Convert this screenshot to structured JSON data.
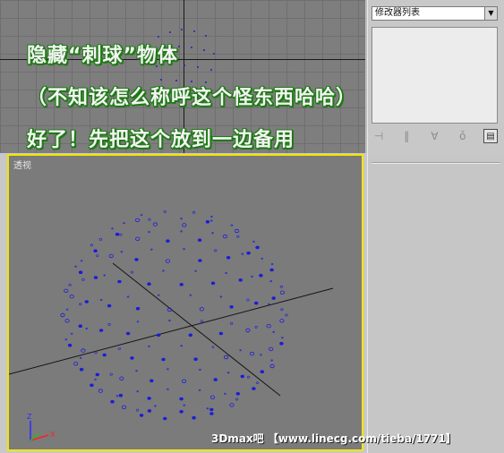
{
  "captions": {
    "line1": "隐藏“刺球”物体",
    "line2": "（不知该怎么称呼这个怪东西哈哈）",
    "line3": "好了！先把这个放到一边备用"
  },
  "command_panel": {
    "modifier_list_label": "修改器列表",
    "stack_toolbar_icons": [
      "pin-stack-icon",
      "show-end-result-icon",
      "make-unique-icon",
      "remove-modifier-icon",
      "configure-modifier-sets-icon"
    ]
  },
  "viewports": {
    "perspective_label": "透视"
  },
  "watermark": "3Dmax吧 【www.linecg.com/tieba/1771】",
  "colors": {
    "active_viewport_border": "#f2e600",
    "caption_outline": "#1e7a14",
    "vertex_dots": "#1c1cd8"
  }
}
